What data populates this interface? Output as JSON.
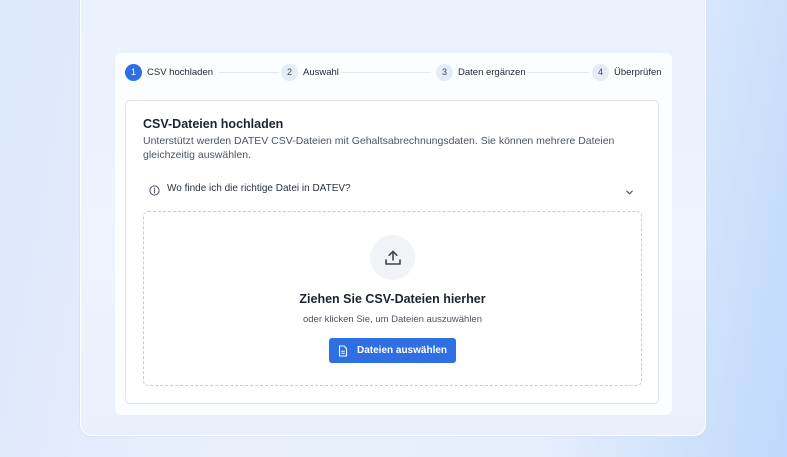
{
  "stepper": {
    "steps": [
      {
        "number": "1",
        "label": "CSV hochladen",
        "state": "active"
      },
      {
        "number": "2",
        "label": "Auswahl",
        "state": "inactive"
      },
      {
        "number": "3",
        "label": "Daten ergänzen",
        "state": "inactive"
      },
      {
        "number": "4",
        "label": "Überprüfen",
        "state": "inactive"
      }
    ]
  },
  "upload": {
    "title": "CSV-Dateien hochladen",
    "description": "Unterstützt werden DATEV CSV-Dateien mit Gehaltsabrechnungsdaten. Sie können mehrere Dateien gleichzeitig auswählen.",
    "faq_label": "Wo finde ich die richtige Datei in DATEV?",
    "faq_icon": "info-icon",
    "dropzone": {
      "icon": "upload-icon",
      "title": "Ziehen Sie CSV-Dateien hierher",
      "subtitle": "oder klicken Sie, um Dateien auszuwählen",
      "button_label": "Dateien auswählen",
      "button_icon": "file-icon"
    }
  },
  "colors": {
    "accent": "#2f6fe4",
    "step_inactive_bg": "#e4ecf8"
  }
}
